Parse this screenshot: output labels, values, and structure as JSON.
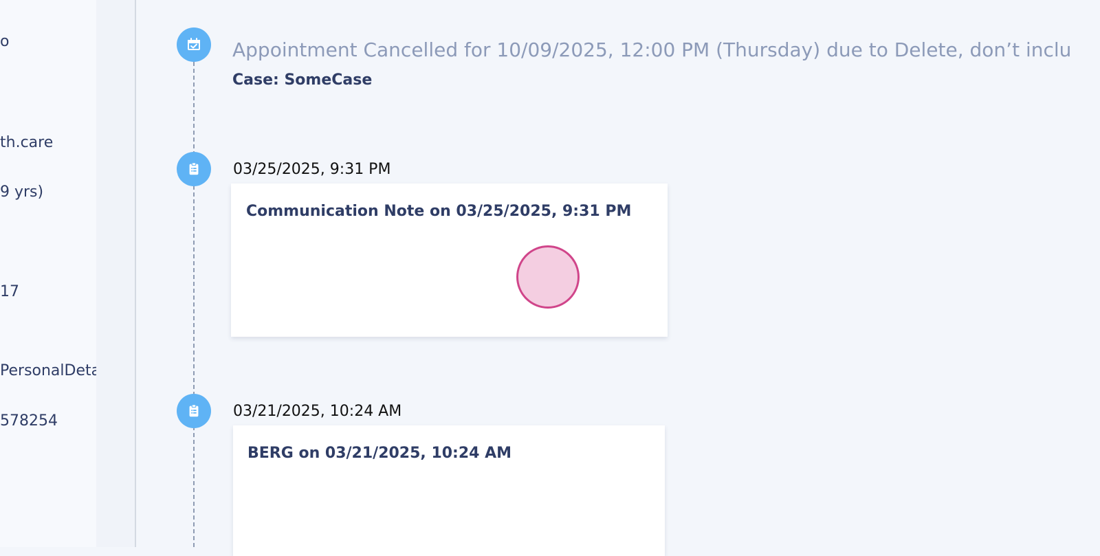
{
  "left_panel": {
    "fragments": [
      "o",
      "th.care",
      "9 yrs)",
      "17",
      "PersonalDetails",
      "578254"
    ]
  },
  "timeline": {
    "events": [
      {
        "title": "Appointment Cancelled for 10/09/2025, 12:00 PM (Thursday) due to Delete, don’t inclu",
        "case": "Case: SomeCase",
        "icon": "calendar-check-icon"
      },
      {
        "timestamp": "03/25/2025, 9:31 PM",
        "card_title": "Communication Note on 03/25/2025, 9:31 PM",
        "icon": "clipboard-icon"
      },
      {
        "timestamp": "03/21/2025, 10:24 AM",
        "card_title": "BERG on 03/21/2025, 10:24 AM",
        "icon": "clipboard-icon"
      }
    ]
  },
  "colors": {
    "node": "#5fb3f5",
    "accent_text": "#2f3d66",
    "muted_text": "#8c9ab8",
    "cursor": "#d0458a"
  }
}
